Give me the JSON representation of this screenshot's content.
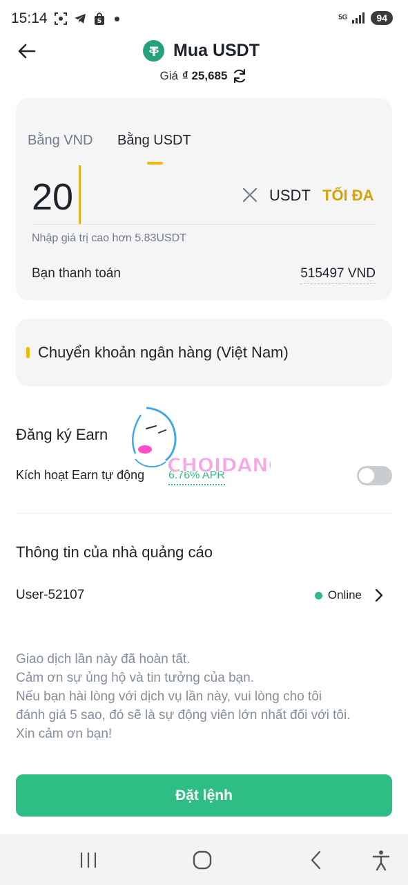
{
  "status_bar": {
    "time": "15:14",
    "network": "5G",
    "battery": "94"
  },
  "header": {
    "title": "Mua USDT",
    "price_label": "Giá",
    "price_value": "₫ 25,685"
  },
  "amount_card": {
    "tabs": [
      {
        "label": "Bằng VND",
        "active": false
      },
      {
        "label": "Bằng USDT",
        "active": true
      }
    ],
    "amount": "20",
    "unit": "USDT",
    "max_label": "TỐI ĐA",
    "hint": "Nhập giá trị cao hơn 5.83USDT",
    "pay_label": "Bạn thanh toán",
    "pay_value": "515497 VND"
  },
  "payment_method": {
    "label": "Chuyển khoản ngân hàng (Việt Nam)"
  },
  "earn": {
    "title": "Đăng ký Earn",
    "auto_label": "Kích hoạt Earn tự động",
    "apr": "6.76% APR",
    "enabled": false
  },
  "advertiser": {
    "title": "Thông tin của nhà quảng cáo",
    "user": "User-52107",
    "status": "Online"
  },
  "terms": {
    "lines": [
      "Giao dịch lần này đã hoàn tất.",
      "Cảm ơn sự ủng hộ và tin tưởng của bạn.",
      "Nếu bạn hài lòng với dịch vụ lần này, vui lòng cho  tôi",
      "đánh giá 5 sao, đó sẽ là sự động viên lớn nhất đối với tôi.",
      "Xin cảm ơn bạn!"
    ]
  },
  "cta": {
    "label": "Đặt lệnh"
  },
  "watermark": {
    "text": "CHOIDANGCAP"
  },
  "colors": {
    "brand_green": "#2ebd85",
    "accent_yellow": "#f0b90b",
    "tether": "#26a17b"
  }
}
